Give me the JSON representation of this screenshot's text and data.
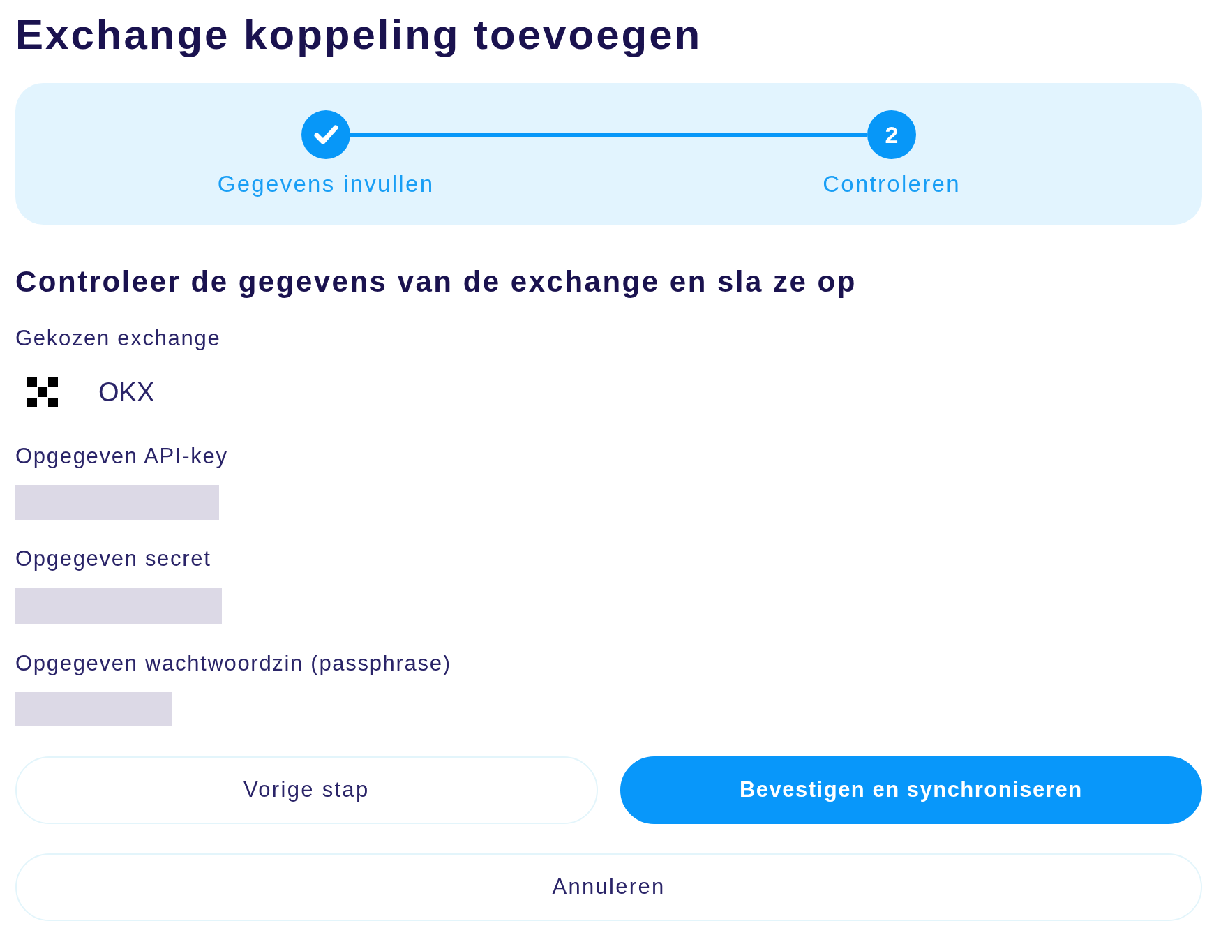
{
  "title": "Exchange koppeling toevoegen",
  "stepper": {
    "steps": [
      {
        "label": "Gegevens invullen",
        "completed": true
      },
      {
        "label": "Controleren",
        "completed": false,
        "number": "2"
      }
    ]
  },
  "heading": "Controleer de gegevens van de exchange en sla ze op",
  "fields": [
    {
      "kind": "exchange",
      "label": "Gekozen exchange",
      "value": "OKX"
    },
    {
      "kind": "redacted",
      "label": "Opgegeven API-key"
    },
    {
      "kind": "redacted",
      "label": "Opgegeven secret"
    },
    {
      "kind": "redacted",
      "label": "Opgegeven wachtwoordzin (passphrase)"
    }
  ],
  "button_rows": [
    [
      {
        "kind": "secondary",
        "label": "Vorige stap"
      },
      {
        "kind": "primary",
        "label": "Bevestigen en synchroniseren"
      }
    ],
    [
      {
        "kind": "secondary",
        "label": "Annuleren"
      }
    ]
  ]
}
